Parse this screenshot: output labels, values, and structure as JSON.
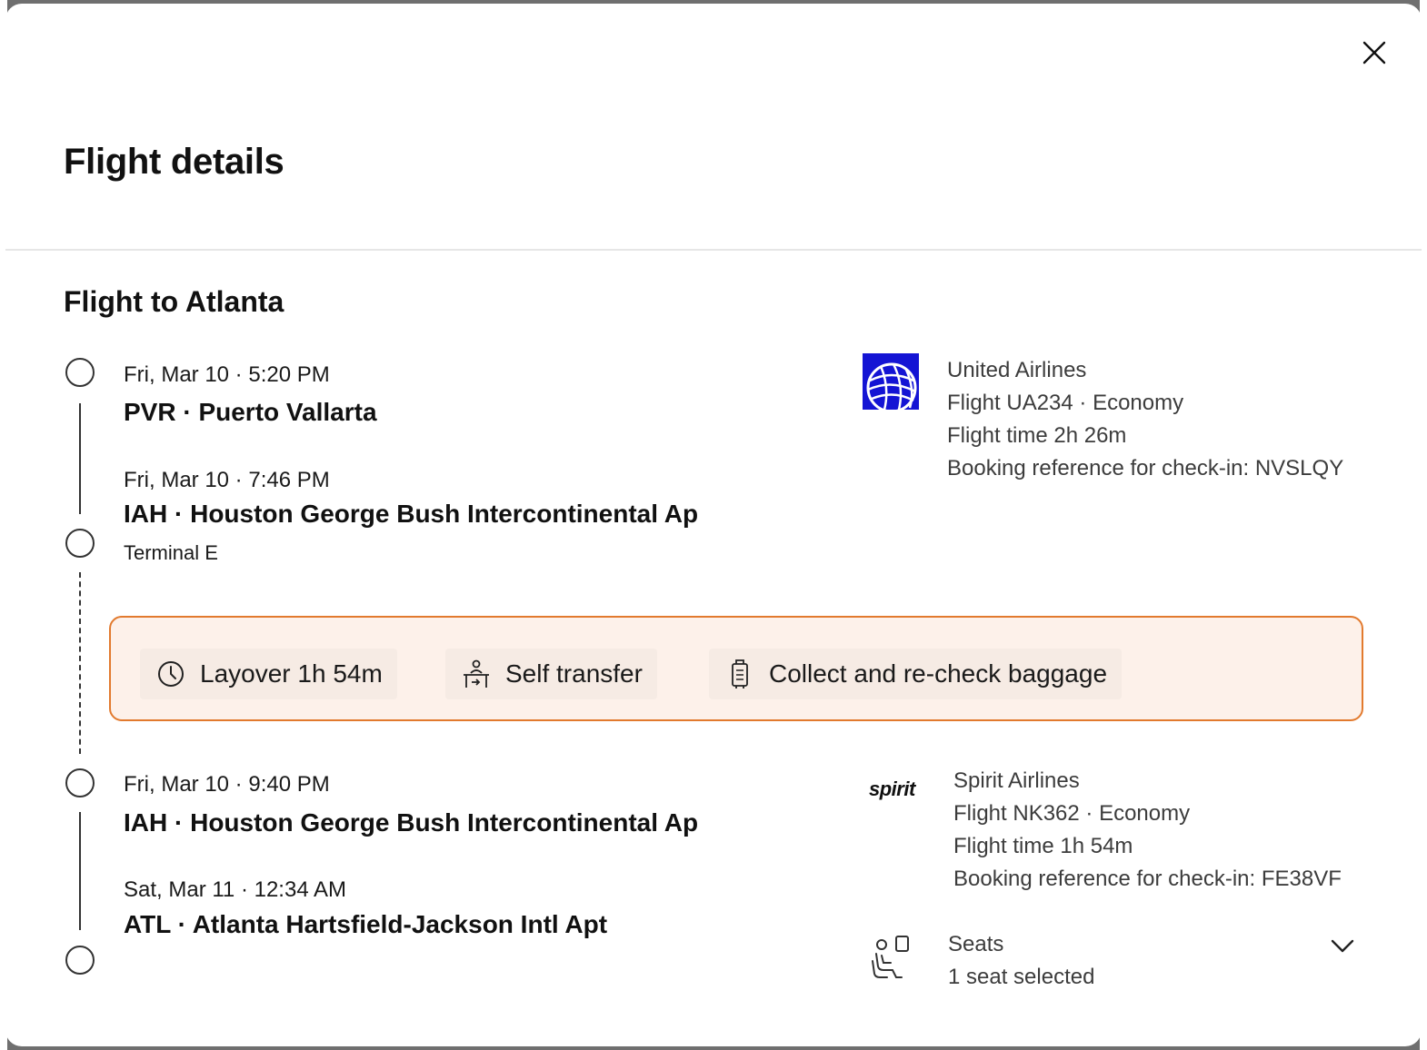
{
  "modal": {
    "title": "Flight details",
    "close_icon": "close-icon"
  },
  "itinerary": {
    "title": "Flight to Atlanta",
    "segments": [
      {
        "departure": {
          "date": "Fri, Mar 10 · 5:20 PM",
          "airport": "PVR · Puerto Vallarta"
        },
        "arrival": {
          "date": "Fri, Mar 10 · 7:46 PM",
          "airport": "IAH · Houston George Bush Intercontinental Ap",
          "terminal": "Terminal E"
        },
        "airline": {
          "name": "United Airlines",
          "flight": "Flight UA234 · Economy",
          "duration": "Flight time 2h 26m",
          "booking": "Booking reference for check-in: NVSLQY",
          "logo": "united-globe-logo"
        }
      },
      {
        "departure": {
          "date": "Fri, Mar 10 · 9:40 PM",
          "airport": "IAH · Houston George Bush Intercontinental Ap"
        },
        "arrival": {
          "date": "Sat, Mar 11 · 12:34 AM",
          "airport": "ATL · Atlanta Hartsfield-Jackson Intl Apt"
        },
        "airline": {
          "name": "Spirit Airlines",
          "flight": "Flight NK362 · Economy",
          "duration": "Flight time 1h 54m",
          "booking": "Booking reference for check-in: FE38VF",
          "logo_text": "spirit"
        },
        "seats": {
          "label": "Seats",
          "value": "1 seat selected"
        }
      }
    ],
    "layover": {
      "items": [
        {
          "label": "Layover 1h 54m",
          "icon": "clock-icon"
        },
        {
          "label": "Self transfer",
          "icon": "transfer-person-icon"
        },
        {
          "label": "Collect and re-check baggage",
          "icon": "luggage-icon"
        }
      ]
    }
  },
  "colors": {
    "layover_border": "#e27a2e",
    "layover_bg": "#fdf1ea",
    "united_blue": "#1414d4"
  }
}
